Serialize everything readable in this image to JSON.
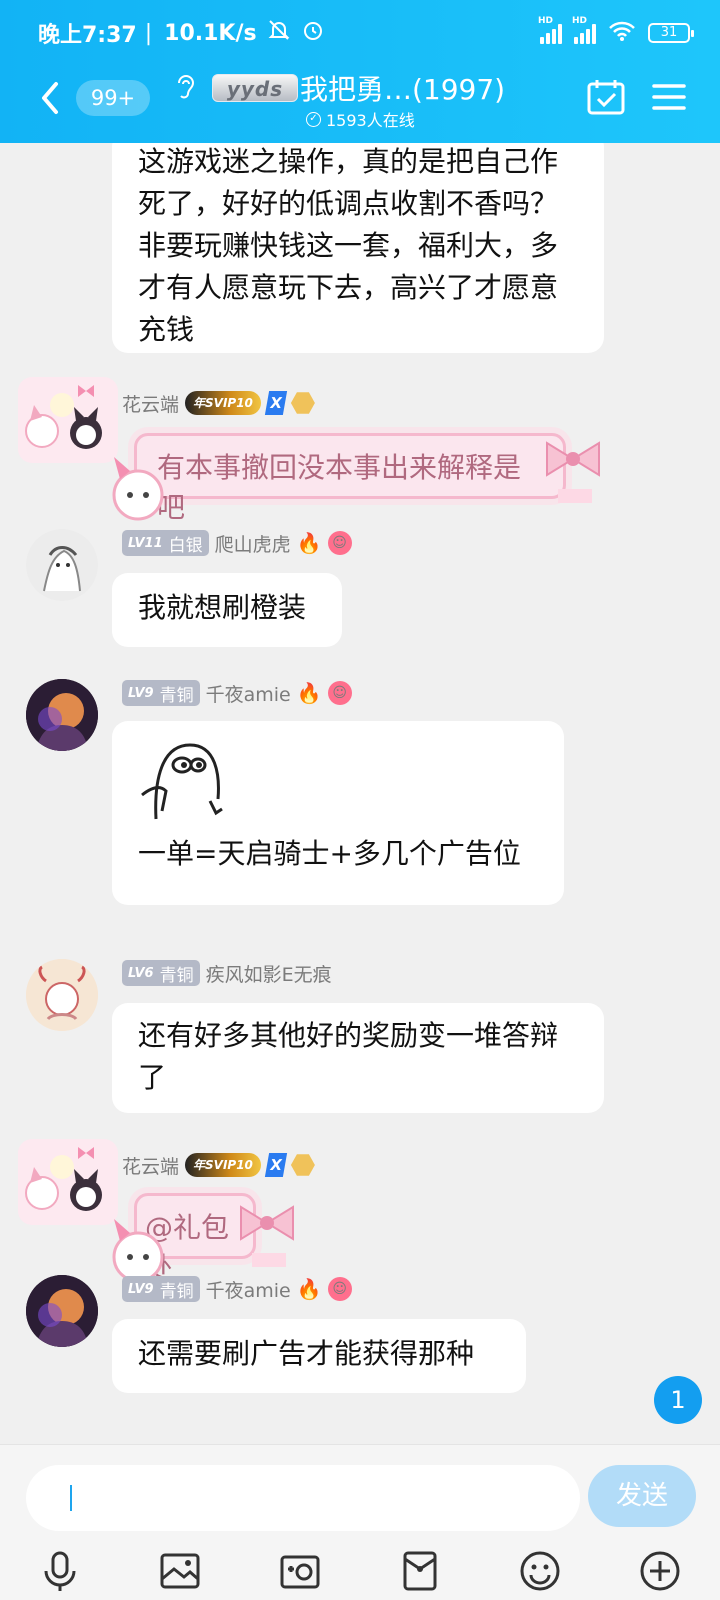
{
  "status_bar": {
    "time": "晚上7:37",
    "speed": "10.1K/s",
    "signal1_label": "HD",
    "signal2_label": "HD",
    "battery": "31"
  },
  "header": {
    "unread_badge": "99+",
    "group_title": "我把勇…(1997)",
    "yyds_badge": "yyds",
    "online_count": "1593人在线"
  },
  "messages": [
    {
      "text": "这游戏迷之操作，真的是把自己作死了，好好的低调点收割不香吗？非要玩赚快钱这一套，福利大，多才有人愿意玩下去，高兴了才愿意充钱"
    },
    {
      "name": "花云端",
      "svip": "年SVIP10",
      "x_badge": "X",
      "text": "有本事撤回没本事出来解释是吧"
    },
    {
      "level": "LV11",
      "rank": "白银",
      "name": "爬山虎虎",
      "text": "我就想刷橙装"
    },
    {
      "level": "LV9",
      "rank": "青铜",
      "name": "千夜amie",
      "text": "一单=天启骑士+多几个广告位"
    },
    {
      "level": "LV6",
      "rank": "青铜",
      "name": "疾风如影E无痕",
      "text": "还有好多其他好的奖励变一堆答辩了"
    },
    {
      "name": "花云端",
      "svip": "年SVIP10",
      "x_badge": "X",
      "text": "@礼包处"
    },
    {
      "level": "LV9",
      "rank": "青铜",
      "name": "千夜amie",
      "text": "还需要刷广告才能获得那种"
    }
  ],
  "unread_count": "1",
  "input": {
    "value": "",
    "send_label": "发送"
  },
  "toolbar_icons": [
    "microphone-icon",
    "image-icon",
    "camera-icon",
    "red-packet-icon",
    "emoji-icon",
    "plus-icon"
  ]
}
